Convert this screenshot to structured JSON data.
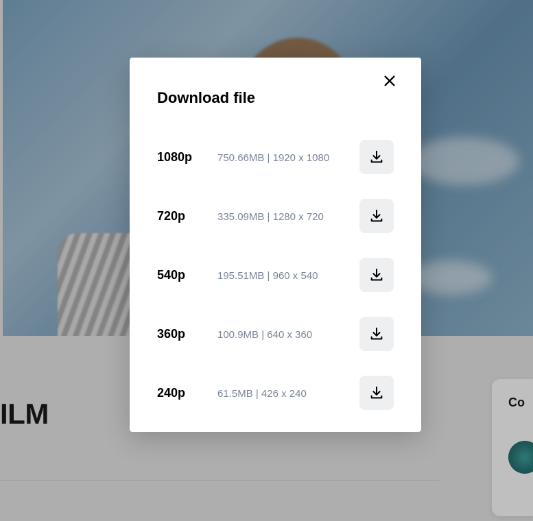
{
  "page": {
    "title_fragment": "ILM",
    "side_card_title_fragment": "Co"
  },
  "modal": {
    "title": "Download file",
    "options": [
      {
        "label": "1080p",
        "size": "750.66MB",
        "dimensions": "1920 x 1080"
      },
      {
        "label": "720p",
        "size": "335.09MB",
        "dimensions": "1280 x 720"
      },
      {
        "label": "540p",
        "size": "195.51MB",
        "dimensions": "960 x 540"
      },
      {
        "label": "360p",
        "size": "100.9MB",
        "dimensions": "640 x 360"
      },
      {
        "label": "240p",
        "size": "61.5MB",
        "dimensions": "426 x 240"
      }
    ]
  }
}
